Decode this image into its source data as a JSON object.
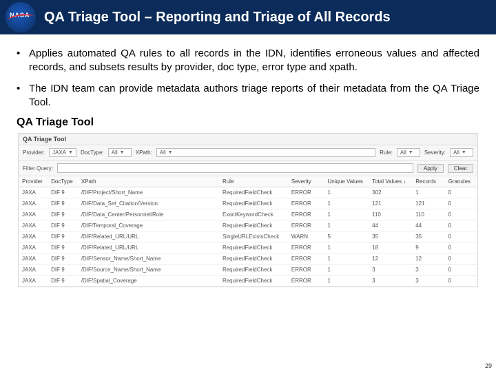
{
  "header": {
    "logo_text": "NASA",
    "title": "QA Triage Tool – Reporting and Triage of All Records"
  },
  "bullets": [
    "Applies automated QA rules to all records in the IDN, identifies erroneous values and affected records, and subsets results by provider, doc type, error type and xpath.",
    "The IDN team can provide metadata authors triage reports of their metadata from the QA Triage Tool."
  ],
  "section_label": "QA Triage Tool",
  "tool": {
    "title": "QA Triage Tool",
    "filters": {
      "provider_label": "Provider:",
      "provider_value": "JAXA",
      "doctype_label": "DocType:",
      "doctype_value": "All",
      "xpath_label": "XPath:",
      "xpath_value": "All",
      "rule_label": "Rule:",
      "rule_value": "All",
      "severity_label": "Severity:",
      "severity_value": "All"
    },
    "query_label": "Filter Query:",
    "apply_label": "Apply",
    "clear_label": "Clear",
    "columns": {
      "provider": "Provider",
      "doctype": "DocType",
      "xpath": "XPath",
      "rule": "Rule",
      "severity": "Severity",
      "uv": "Unique Values",
      "tv": "Total Values ↓",
      "records": "Records",
      "granules": "Granules"
    },
    "rows": [
      {
        "provider": "JAXA",
        "doctype": "DIF 9",
        "xpath": "/DIF/Project/Short_Name",
        "rule": "RequiredFieldCheck",
        "severity": "ERROR",
        "uv": "1",
        "tv": "302",
        "records": "1",
        "granules": "0"
      },
      {
        "provider": "JAXA",
        "doctype": "DIF 9",
        "xpath": "/DIF/Data_Set_Citation/Version",
        "rule": "RequiredFieldCheck",
        "severity": "ERROR",
        "uv": "1",
        "tv": "121",
        "records": "121",
        "granules": "0"
      },
      {
        "provider": "JAXA",
        "doctype": "DIF 9",
        "xpath": "/DIF/Data_Center/Personnel/Role",
        "rule": "ExactKeywordCheck",
        "severity": "ERROR",
        "uv": "1",
        "tv": "110",
        "records": "110",
        "granules": "0"
      },
      {
        "provider": "JAXA",
        "doctype": "DIF 9",
        "xpath": "/DIF/Temporal_Coverage",
        "rule": "RequiredFieldCheck",
        "severity": "ERROR",
        "uv": "1",
        "tv": "44",
        "records": "44",
        "granules": "0"
      },
      {
        "provider": "JAXA",
        "doctype": "DIF 9",
        "xpath": "/DIF/Related_URL/URL",
        "rule": "SingleURLExistsCheck",
        "severity": "WARN",
        "uv": "5",
        "tv": "35",
        "records": "35",
        "granules": "0"
      },
      {
        "provider": "JAXA",
        "doctype": "DIF 9",
        "xpath": "/DIF/Related_URL/URL",
        "rule": "RequiredFieldCheck",
        "severity": "ERROR",
        "uv": "1",
        "tv": "18",
        "records": "9",
        "granules": "0"
      },
      {
        "provider": "JAXA",
        "doctype": "DIF 9",
        "xpath": "/DIF/Sensor_Name/Short_Name",
        "rule": "RequiredFieldCheck",
        "severity": "ERROR",
        "uv": "1",
        "tv": "12",
        "records": "12",
        "granules": "0"
      },
      {
        "provider": "JAXA",
        "doctype": "DIF 9",
        "xpath": "/DIF/Source_Name/Short_Name",
        "rule": "RequiredFieldCheck",
        "severity": "ERROR",
        "uv": "1",
        "tv": "3",
        "records": "3",
        "granules": "0"
      },
      {
        "provider": "JAXA",
        "doctype": "DIF 9",
        "xpath": "/DIF/Spatial_Coverage",
        "rule": "RequiredFieldCheck",
        "severity": "ERROR",
        "uv": "1",
        "tv": "3",
        "records": "3",
        "granules": "0"
      }
    ]
  },
  "page_number": "29"
}
